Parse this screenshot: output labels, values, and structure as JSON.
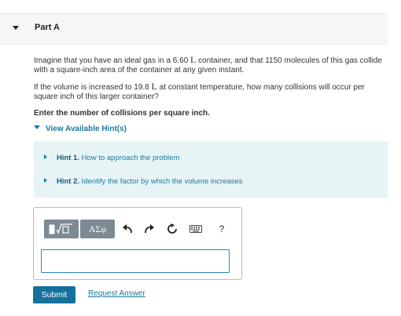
{
  "part": {
    "title": "Part A"
  },
  "problem": {
    "intro_a": "Imagine that you have an ideal gas in a 6.60 ",
    "intro_unit": "L",
    "intro_b": " container, and that 1150 molecules of this gas collide with a square-inch area of the container at any given instant.",
    "question_a": "If the volume is increased to 19.8 ",
    "question_unit": "L",
    "question_b": " at constant temperature, how many collisions will occur per square inch of this larger container?",
    "instruction": "Enter the number of collisions per square inch."
  },
  "hints": {
    "toggle_label": "View Available Hint(s)",
    "items": [
      {
        "number": "Hint 1.",
        "text": "How to approach the problem"
      },
      {
        "number": "Hint 2.",
        "text": "Identify the factor by which the volume increases"
      }
    ]
  },
  "toolbar": {
    "templates_label": "√□",
    "symbols_label": "ΑΣφ",
    "help_label": "?"
  },
  "actions": {
    "submit_label": "Submit",
    "request_answer_label": "Request Answer"
  }
}
